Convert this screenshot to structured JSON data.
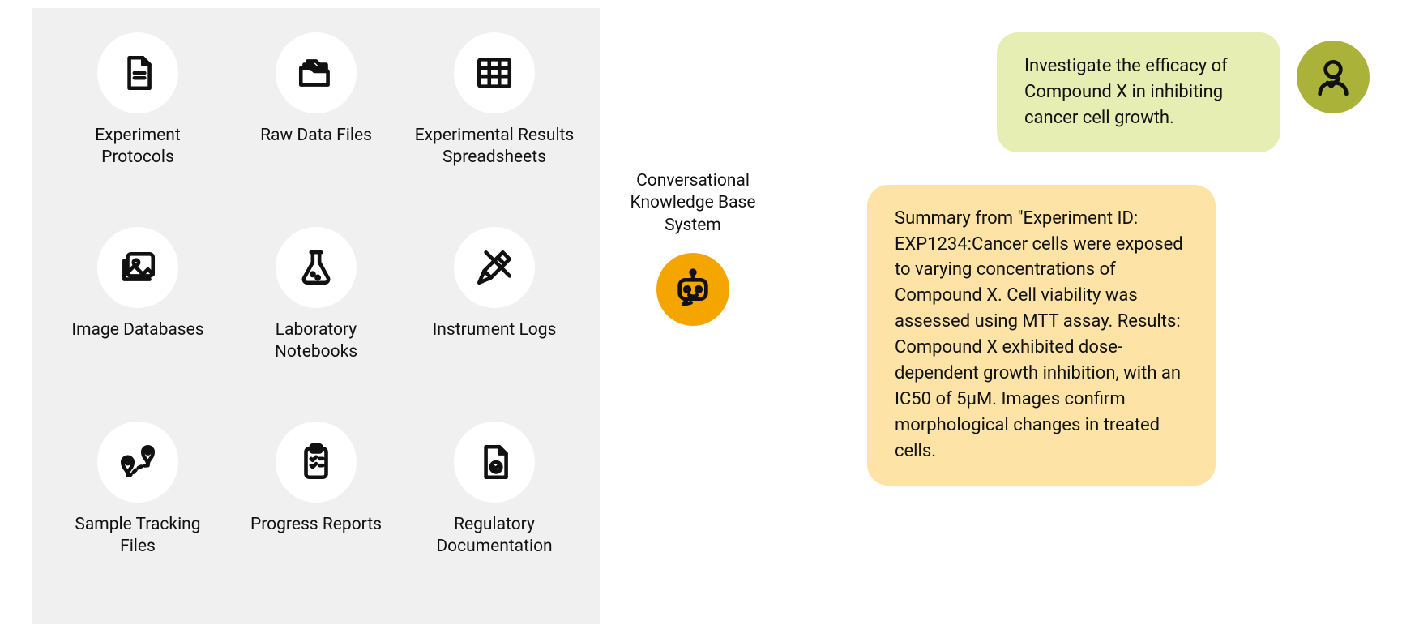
{
  "left": {
    "tiles": [
      {
        "label": "Experiment Protocols",
        "icon": "file-text-icon"
      },
      {
        "label": "Raw Data Files",
        "icon": "folders-icon"
      },
      {
        "label": "Experimental Results Spreadsheets",
        "icon": "table-icon"
      },
      {
        "label": "Image Databases",
        "icon": "images-icon"
      },
      {
        "label": "Laboratory Notebooks",
        "icon": "flask-icon"
      },
      {
        "label": "Instrument Logs",
        "icon": "tools-icon"
      },
      {
        "label": "Sample Tracking Files",
        "icon": "route-pins-icon"
      },
      {
        "label": "Progress Reports",
        "icon": "clipboard-list-icon"
      },
      {
        "label": "Regulatory Documentation",
        "icon": "file-check-icon"
      }
    ]
  },
  "middle": {
    "label": "Conversational Knowledge Base System",
    "avatar": "robot-icon"
  },
  "chat": {
    "user": {
      "text": "Investigate the efficacy of Compound X in inhibiting cancer cell growth.",
      "avatar": "person-icon"
    },
    "bot": {
      "text": "Summary from \"Experiment ID: EXP1234:Cancer cells were exposed to varying concentrations of Compound X. Cell viability was assessed using MTT assay. Results: Compound X exhibited dose-dependent growth inhibition, with an IC50 of 5µM. Images confirm morphological changes in treated cells."
    }
  }
}
